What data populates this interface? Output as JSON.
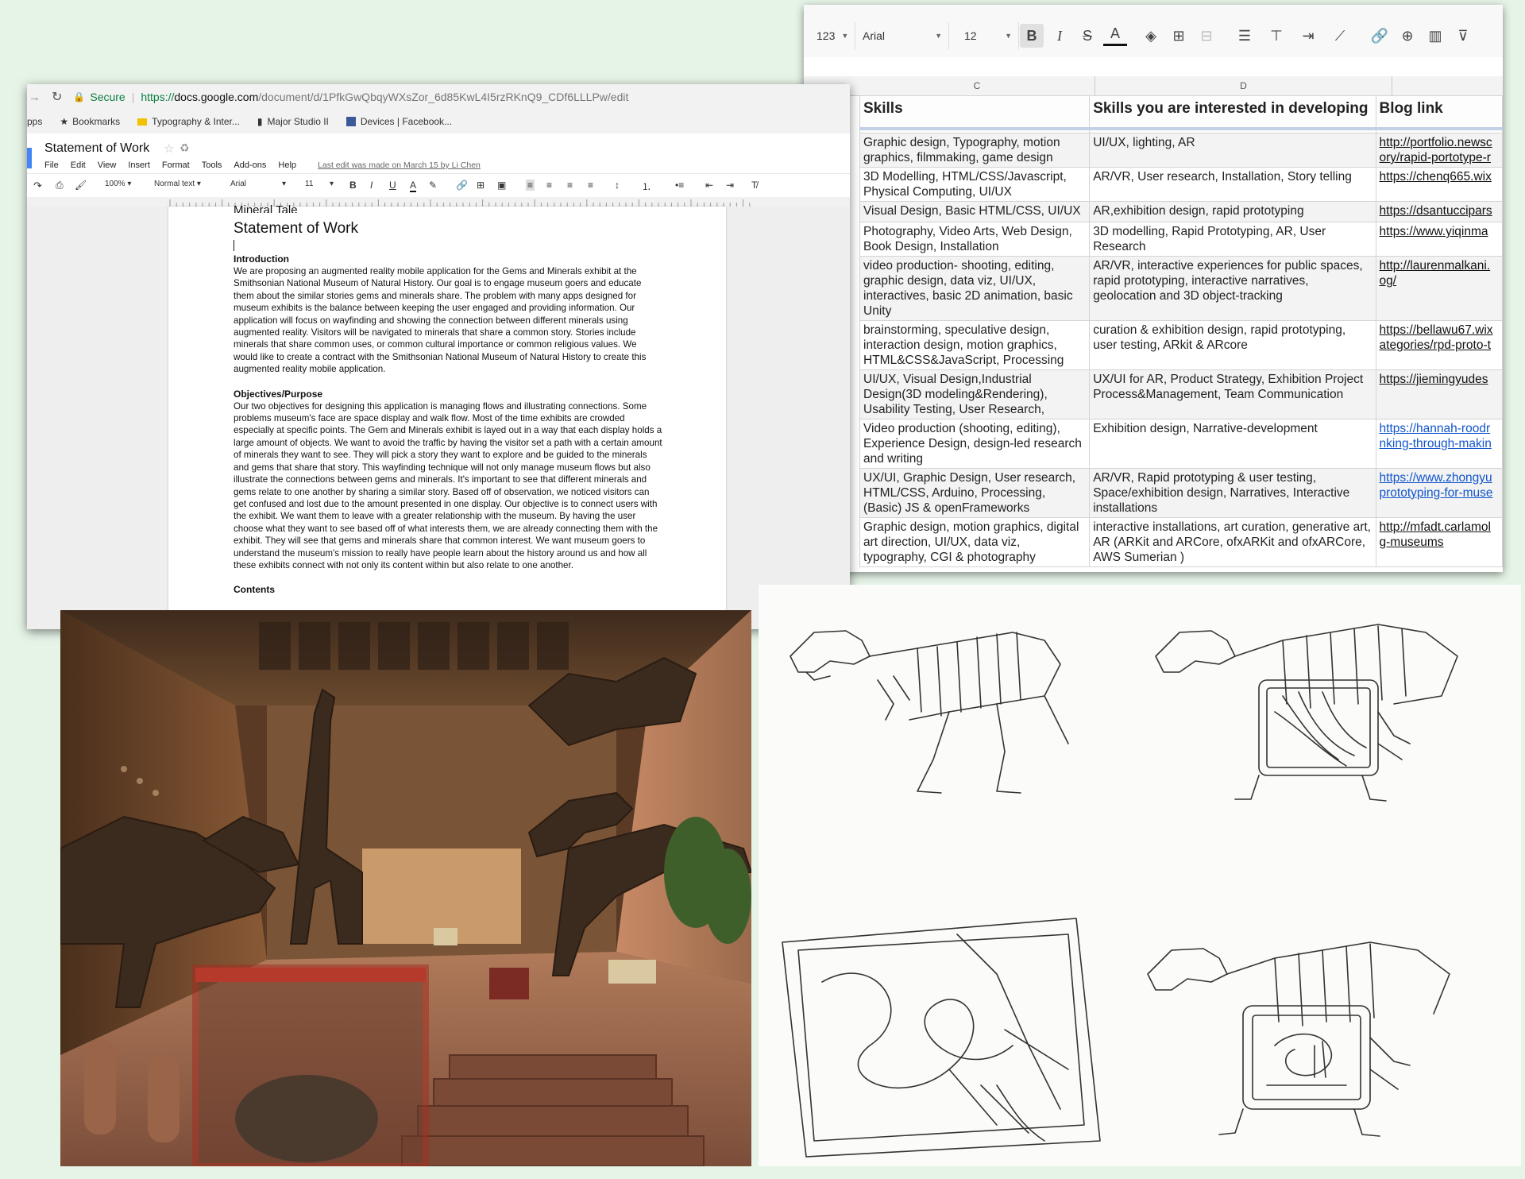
{
  "sheet": {
    "toolbar": {
      "number_format": "123",
      "font": "Arial",
      "size": "12",
      "icons": [
        "bold-icon",
        "italic-icon",
        "strikethrough-icon",
        "text-color-icon",
        "fill-color-icon",
        "borders-icon",
        "merge-icon",
        "align-left-icon",
        "valign-icon",
        "text-wrap-icon",
        "text-rotate-icon",
        "link-icon",
        "insert-comment-icon",
        "chart-icon",
        "filter-icon"
      ]
    },
    "columns": [
      "C",
      "D"
    ],
    "headers": [
      "Skills",
      "Skills you are interested in developing",
      "Blog link"
    ],
    "rows": [
      {
        "skills": "Graphic design, Typography, motion graphics, filmmaking, game design",
        "developing": "UI/UX, lighting, AR",
        "link": "http://portfolio.newsc ory/rapid-portotype-r",
        "link_style": "dark"
      },
      {
        "skills": "3D Modelling, HTML/CSS/Javascript, Physical Computing, UI/UX",
        "developing": "AR/VR, User research, Installation, Story telling",
        "link": "https://chenq665.wix",
        "link_style": "dark"
      },
      {
        "skills": "Visual Design, Basic HTML/CSS, UI/UX",
        "developing": "AR,exhibition design, rapid prototyping",
        "link": "https://dsantuccipars",
        "link_style": "dark"
      },
      {
        "skills": "Photography, Video Arts, Web Design, Book Design, Installation",
        "developing": "3D modelling, Rapid Prototyping, AR, User Research",
        "link": "https://www.yiqinma",
        "link_style": "dark"
      },
      {
        "skills": "video production- shooting, editing, graphic design, data viz, UI/UX, interactives, basic 2D animation, basic Unity",
        "developing": "AR/VR, interactive experiences for public spaces, rapid prototyping, interactive narratives, geolocation and 3D object-tracking",
        "link": "http://laurenmalkani. og/",
        "link_style": "dark"
      },
      {
        "skills": "brainstorming, speculative design, interaction design, motion graphics, HTML&CSS&JavaScript, Processing",
        "developing": "curation & exhibition design, rapid prototyping, user testing, ARkit & ARcore",
        "link": "https://bellawu67.wix ategories/rpd-proto-t",
        "link_style": "dark"
      },
      {
        "skills": "UI/UX, Visual Design,Industrial Design(3D modeling&Rendering), Usability Testing, User Research,",
        "developing": "UX/UI for AR, Product Strategy, Exhibition Project Process&Management, Team Communication",
        "link": "https://jiemingyudes",
        "link_style": "dark"
      },
      {
        "skills": "Video production (shooting, editing), Experience Design, design-led research and writing",
        "developing": "Exhibition design,  Narrative-development",
        "link": "https://hannah-roodr nking-through-makin",
        "link_style": "blue"
      },
      {
        "skills": "UX/UI, Graphic Design, User research, HTML/CSS, Arduino, Processing, (Basic) JS & openFrameworks",
        "developing": "AR/VR, Rapid prototyping & user testing, Space/exhibition design, Narratives, Interactive installations",
        "link": "https://www.zhongyu prototyping-for-muse",
        "link_style": "blue"
      },
      {
        "skills": "Graphic design, motion graphics, digital art direction, UI/UX, data viz, typography, CGI & photography",
        "developing": "interactive installations, art curation, generative art, AR (ARKit and ARCore, ofxARKit and ofxARCore, AWS Sumerian )",
        "link": "http://mfadt.carlamol g-museums",
        "link_style": "dark"
      }
    ]
  },
  "doc": {
    "browser": {
      "secure": "Secure",
      "url_scheme": "https://",
      "url_host": "docs.google.com",
      "url_path": "/document/d/1PfkGwQbqyWXsZor_6d85KwL4I5rzRKnQ9_CDf6LLLPw/edit"
    },
    "bookmarks": [
      "pps",
      "Bookmarks",
      "Typography & Inter...",
      "Major Studio II",
      "Devices | Facebook..."
    ],
    "title": "Statement of Work",
    "menu": [
      "File",
      "Edit",
      "View",
      "Insert",
      "Format",
      "Tools",
      "Add-ons",
      "Help"
    ],
    "last_edit": "Last edit was made on March 15 by Li Chen",
    "format_bar": {
      "zoom": "100%",
      "style": "Normal text",
      "font": "Arial",
      "size": "11"
    },
    "content": {
      "cut_title": "Mineral Tale",
      "heading": "Statement of Work",
      "intro_title": "Introduction",
      "intro_text": "We are proposing an augmented reality mobile application for the Gems and Minerals exhibit at the Smithsonian National Museum of Natural History. Our goal is to engage museum goers and educate them about the similar stories gems and minerals share. The problem with many apps designed for museum exhibits is the balance between keeping the user engaged and providing information. Our application will focus on wayfinding and showing the connection between different minerals using augmented reality. Visitors will be navigated to minerals that share a common story. Stories include minerals that share common uses, or common cultural importance or common religious values. We would like to create a contract with the Smithsonian National Museum of Natural History to create this augmented reality mobile application.",
      "obj_title": "Objectives/Purpose",
      "obj_text": "Our two objectives for designing this application is managing flows and illustrating connections. Some problems museum's face are space display and walk flow. Most of the time exhibits are crowded especially at specific points. The Gem and Minerals exhibit is layed out in a way that each display holds a large amount of objects. We want to avoid the traffic by having the visitor set a path with a certain amount of minerals they want to see. They will pick a story they want to explore and be guided to the minerals and gems that share that story. This wayfinding technique will not only manage museum flows but also illustrate the connections between gems and minerals. It's important to see that different minerals and gems relate to one another by sharing a similar story. Based off of observation, we noticed visitors can get confused and lost due to the amount presented in one display. Our objective is to connect users with the exhibit. We want them to leave with a greater relationship with the museum. By having the user choose what they want to see based off of what interests them, we are already connecting them with the exhibit. They will see that gems and minerals share that common interest. We want museum goers to understand the museum's mission to really have people learn about the history around us and how all these exhibits connect with not only its content within but also relate to one another.",
      "contents_cut": "Contents"
    }
  },
  "colors": {
    "background": "#e6f4e7",
    "secure_green": "#0b8043",
    "link_blue": "#1155cc"
  }
}
